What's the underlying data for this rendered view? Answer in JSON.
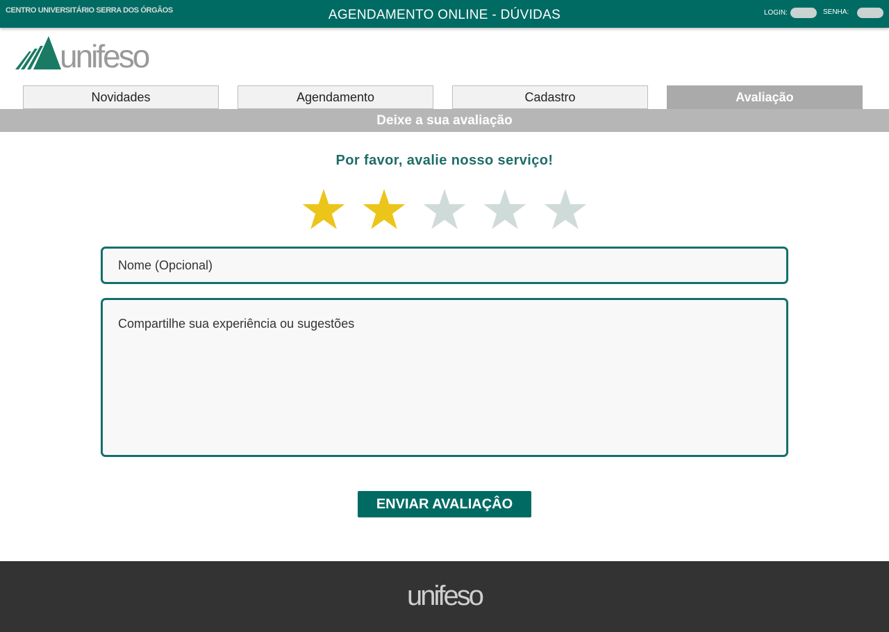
{
  "header": {
    "org_name": "CENTRO UNIVERSITÁRIO SERRA DOS ÓRGÃOS",
    "title": "AGENDAMENTO ONLINE  -  DÚVIDAS",
    "login_label": "LOGIN:",
    "senha_label": "SENHA:"
  },
  "logo": {
    "text": "unifeso"
  },
  "tabs": [
    {
      "label": "Novidades"
    },
    {
      "label": "Agendamento"
    },
    {
      "label": "Cadastro"
    },
    {
      "label": "Avaliação",
      "active": true
    }
  ],
  "section": {
    "title": "Deixe a sua avaliação"
  },
  "rating": {
    "prompt": "Por favor, avalie nosso serviço!",
    "value": 2,
    "max": 5,
    "filled_color": "#ecc51a",
    "empty_color": "#cfdbd9"
  },
  "form": {
    "name_placeholder": "Nome  (Opcional)",
    "message_placeholder": "Compartilhe sua experiência ou sugestões",
    "submit_label": "ENVIAR AVALIAÇÂO"
  },
  "footer": {
    "logo_text": "unifeso"
  },
  "colors": {
    "brand": "#006b63",
    "footer": "#333333"
  }
}
